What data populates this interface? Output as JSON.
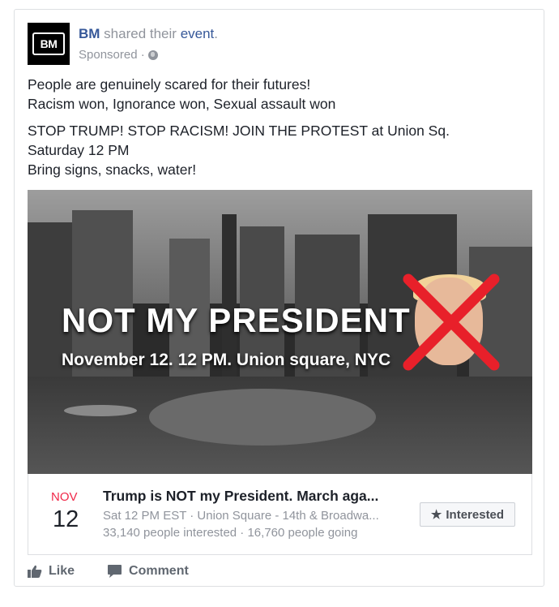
{
  "post": {
    "page_name": "BM",
    "avatar_text": "BM",
    "verb": " shared their ",
    "object": "event",
    "trailing": ".",
    "sponsored": "Sponsored ·",
    "body": [
      "People are genuinely scared for their futures!\nRacism won, Ignorance won, Sexual assault won",
      "STOP TRUMP! STOP RACISM! JOIN THE PROTEST at Union Sq.\nSaturday 12 PM\nBring signs, snacks, water!"
    ]
  },
  "media": {
    "headline": "NOT MY PRESIDENT",
    "dateline": "November 12. 12 PM. Union square, NYC"
  },
  "event": {
    "month": "NOV",
    "day": "12",
    "title": "Trump is NOT my President. March aga...",
    "meta": "Sat 12 PM EST · Union Square - 14th & Broadwa...",
    "counts": "33,140 people interested · 16,760 people going",
    "interested_label": "Interested",
    "month_color": "#f02849"
  },
  "actions": {
    "like": "Like",
    "comment": "Comment"
  },
  "colors": {
    "link": "#365899",
    "muted": "#90949c",
    "border": "#dddfe2"
  }
}
